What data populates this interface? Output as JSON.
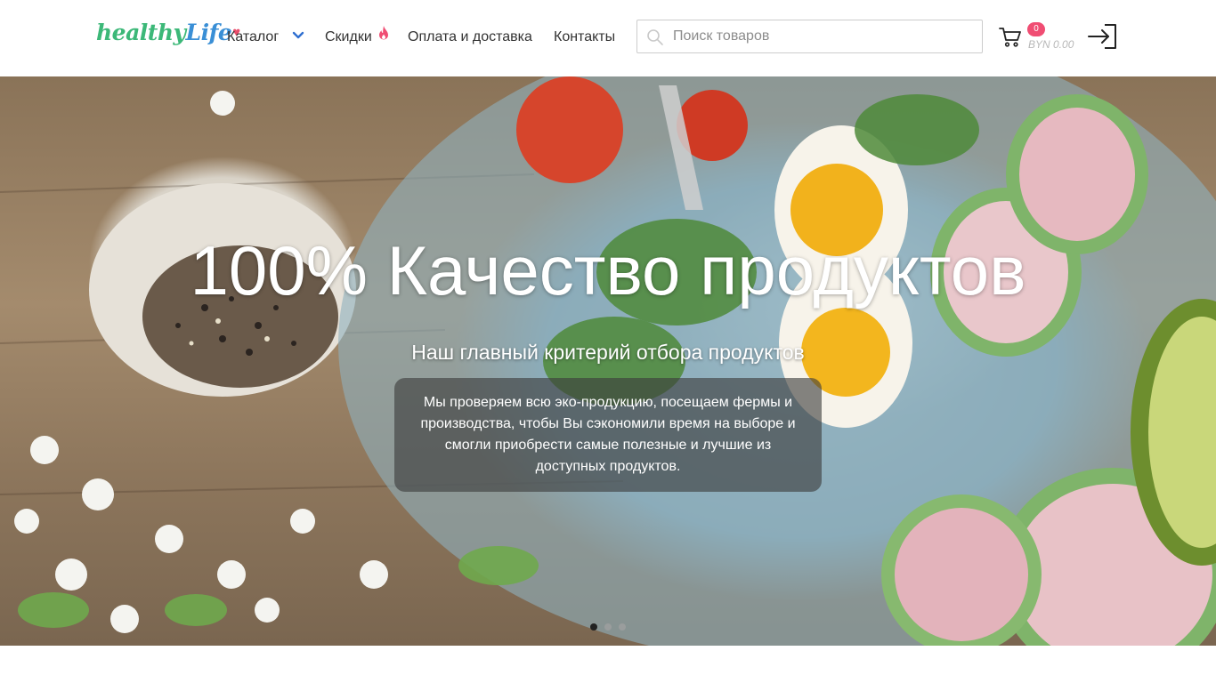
{
  "logo": {
    "part1": "healthy",
    "part2": "Life",
    "heart": "♥"
  },
  "nav": {
    "catalog": "Каталог",
    "discounts": "Скидки",
    "payment_delivery": "Оплата и доставка",
    "contacts": "Контакты"
  },
  "search": {
    "placeholder": "Поиск товаров",
    "value": ""
  },
  "cart": {
    "count": "0",
    "total": "BYN 0.00"
  },
  "icons": {
    "catalog": "chevron-down-icon",
    "discounts": "fire-icon",
    "search": "search-icon",
    "cart": "cart-icon",
    "login": "login-icon"
  },
  "colors": {
    "brand_green": "#3cb878",
    "brand_blue": "#3a8fd6",
    "accent_pink": "#f04d73",
    "chevron_blue": "#2f6fd0"
  },
  "hero": {
    "title": "100% Качество продуктов",
    "subtitle": "Наш главный критерий отбора продуктов",
    "description": "Мы проверяем всю эко-продукцию, посещаем фермы и производства, чтобы Вы сэкономили время на выборе и смогли приобрести самые полезные и лучшие из доступных продуктов.",
    "slides_total": 3,
    "active_slide": 1
  }
}
